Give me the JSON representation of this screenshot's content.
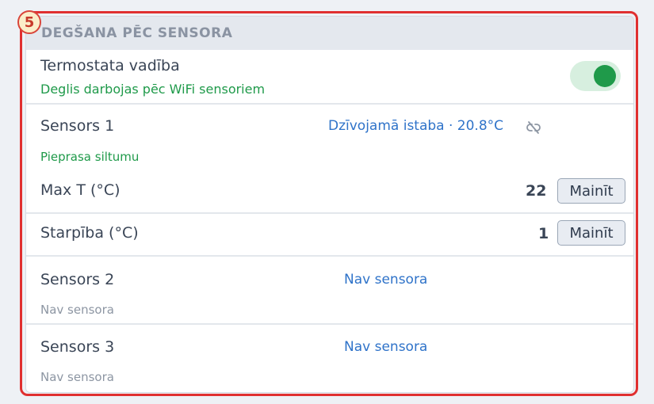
{
  "step_badge": "5",
  "section": {
    "title": "DEGŠANA PĒC SENSORA"
  },
  "thermostat": {
    "label": "Termostata vadība",
    "subtitle": "Deglis darbojas pēc WiFi sensoriem",
    "enabled": true
  },
  "sensor1": {
    "label": "Sensors 1",
    "value": "Dzīvojamā istaba · 20.8°C",
    "status": "Pieprasa siltumu",
    "icon": "unlink-icon"
  },
  "max_t": {
    "label": "Max T (°C)",
    "value": "22",
    "button": "Mainīt"
  },
  "diff": {
    "label": "Starpība (°C)",
    "value": "1",
    "button": "Mainīt"
  },
  "sensor2": {
    "label": "Sensors 2",
    "value": "Nav sensora",
    "status": "Nav sensora"
  },
  "sensor3": {
    "label": "Sensors 3",
    "value": "Nav sensora",
    "status": "Nav sensora"
  },
  "colors": {
    "accent_green": "#1f9a4a",
    "link_blue": "#2f73c9",
    "highlight_red": "#e03030"
  }
}
